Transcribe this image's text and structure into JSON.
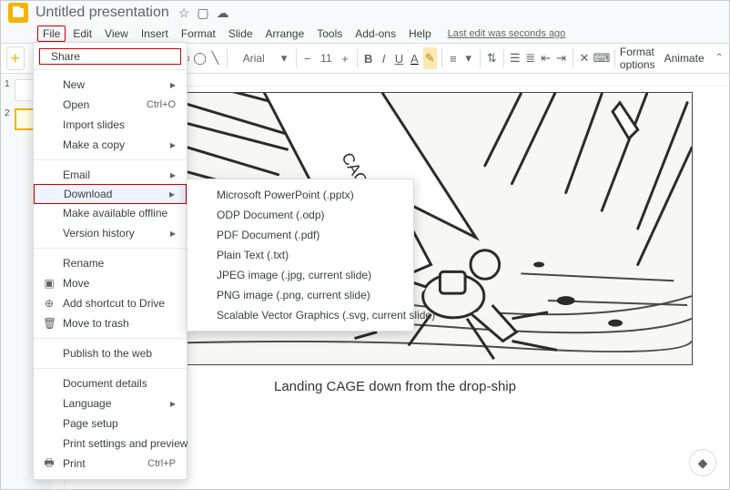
{
  "title": "Untitled presentation",
  "menubar": [
    "File",
    "Edit",
    "View",
    "Insert",
    "Format",
    "Slide",
    "Arrange",
    "Tools",
    "Add-ons",
    "Help"
  ],
  "last_edit": "Last edit was seconds ago",
  "toolbar": {
    "font": "Arial",
    "size": "11",
    "format_options": "Format options",
    "animate": "Animate"
  },
  "thumbs": [
    {
      "num": "1"
    },
    {
      "num": "2"
    }
  ],
  "caption": "Landing CAGE down from the drop-ship",
  "sketch_label": "CAGE",
  "file_menu": {
    "share": "Share",
    "new": "New",
    "open": "Open",
    "open_shortcut": "Ctrl+O",
    "import": "Import slides",
    "copy": "Make a copy",
    "email": "Email",
    "download": "Download",
    "offline": "Make available offline",
    "version": "Version history",
    "rename": "Rename",
    "move": "Move",
    "shortcut": "Add shortcut to Drive",
    "trash": "Move to trash",
    "publish": "Publish to the web",
    "details": "Document details",
    "language": "Language",
    "page_setup": "Page setup",
    "print_settings": "Print settings and preview",
    "print": "Print",
    "print_shortcut": "Ctrl+P"
  },
  "download_menu": [
    "Microsoft PowerPoint (.pptx)",
    "ODP Document (.odp)",
    "PDF Document (.pdf)",
    "Plain Text (.txt)",
    "JPEG image (.jpg, current slide)",
    "PNG image (.png, current slide)",
    "Scalable Vector Graphics (.svg, current slide)"
  ]
}
